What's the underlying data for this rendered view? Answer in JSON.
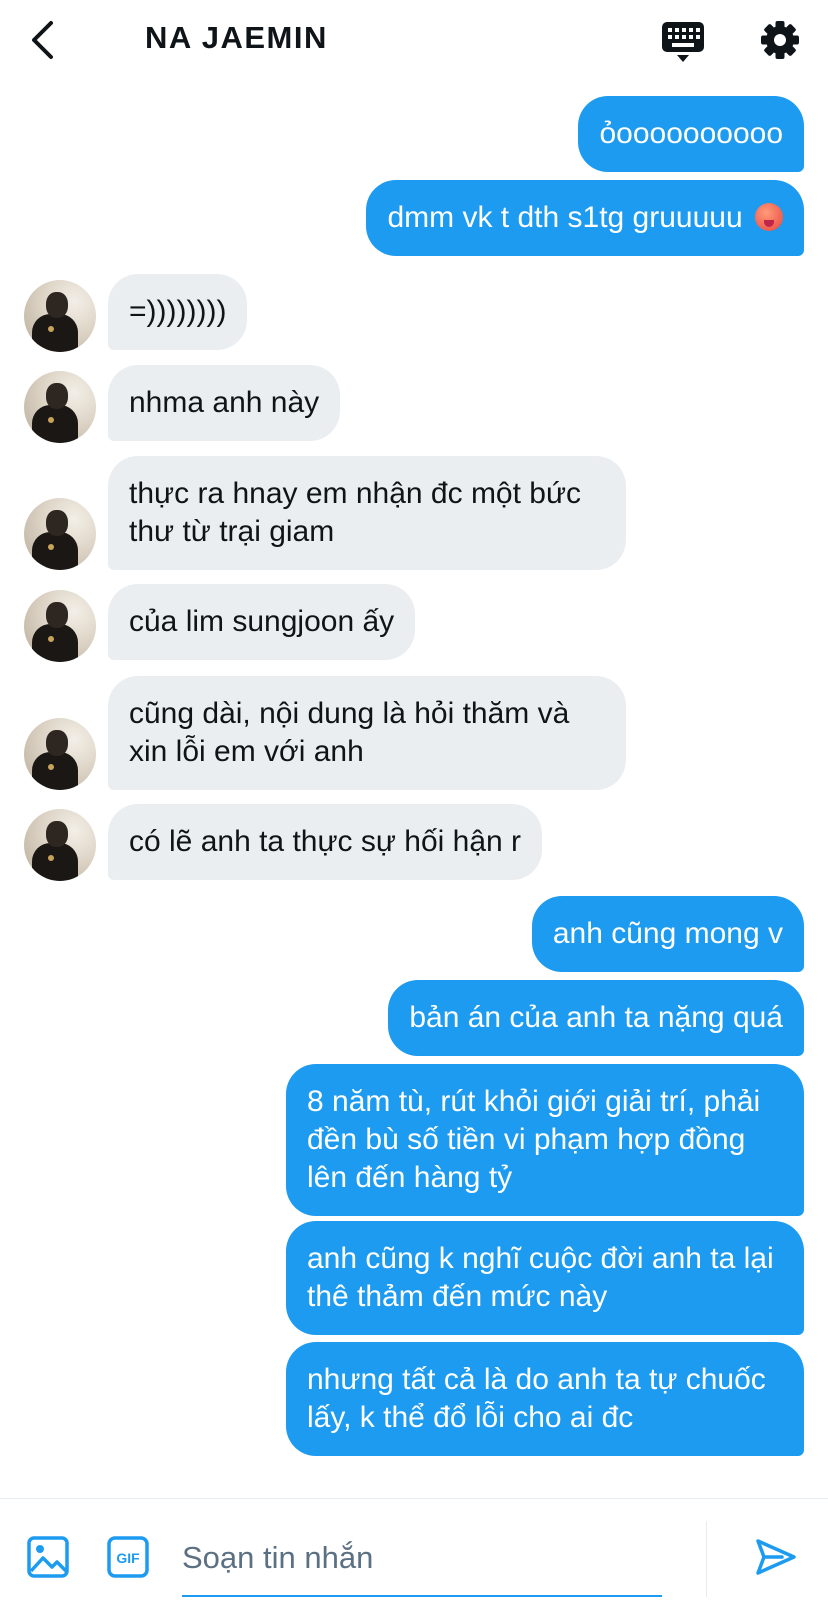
{
  "header": {
    "title": "NA JAEMIN",
    "icons": {
      "back": "chevron-left-icon",
      "keyboard": "keyboard-icon",
      "settings": "gear-icon"
    }
  },
  "messages": [
    {
      "direction": "out",
      "text": "ỏoooooooooo"
    },
    {
      "direction": "out",
      "text": "dmm vk t dth s1tg gruuuuu",
      "emoji": "hot-face-emoji"
    },
    {
      "direction": "in",
      "text": "=))))))))"
    },
    {
      "direction": "in",
      "text": "nhma anh này"
    },
    {
      "direction": "in",
      "text": "thực ra hnay em nhận đc một bức thư từ trại giam"
    },
    {
      "direction": "in",
      "text": "của lim sungjoon ấy"
    },
    {
      "direction": "in",
      "text": "cũng dài, nội dung là hỏi thăm và xin lỗi em với anh"
    },
    {
      "direction": "in",
      "text": "có lẽ anh ta thực sự hối hận r"
    },
    {
      "direction": "out",
      "text": "anh cũng mong v"
    },
    {
      "direction": "out",
      "text": "bản án của anh ta nặng quá"
    },
    {
      "direction": "out",
      "text": "8 năm tù, rút khỏi giới giải trí, phải đền bù số tiền vi phạm hợp đồng lên đến hàng tỷ"
    },
    {
      "direction": "out",
      "text": "anh cũng k nghĩ cuộc đời anh ta lại thê thảm đến mức này"
    },
    {
      "direction": "out",
      "text": "nhưng tất cả là do anh ta tự chuốc lấy, k thể đổ lỗi cho ai đc"
    }
  ],
  "composer": {
    "placeholder": "Soạn tin nhắn",
    "gif_label": "GIF",
    "icons": {
      "image": "image-icon",
      "gif": "gif-icon",
      "send": "send-icon"
    }
  },
  "colors": {
    "accent": "#1d9bf0",
    "incoming_bubble": "#ebeef0",
    "text": "#0f1419",
    "placeholder": "#5b7083"
  }
}
